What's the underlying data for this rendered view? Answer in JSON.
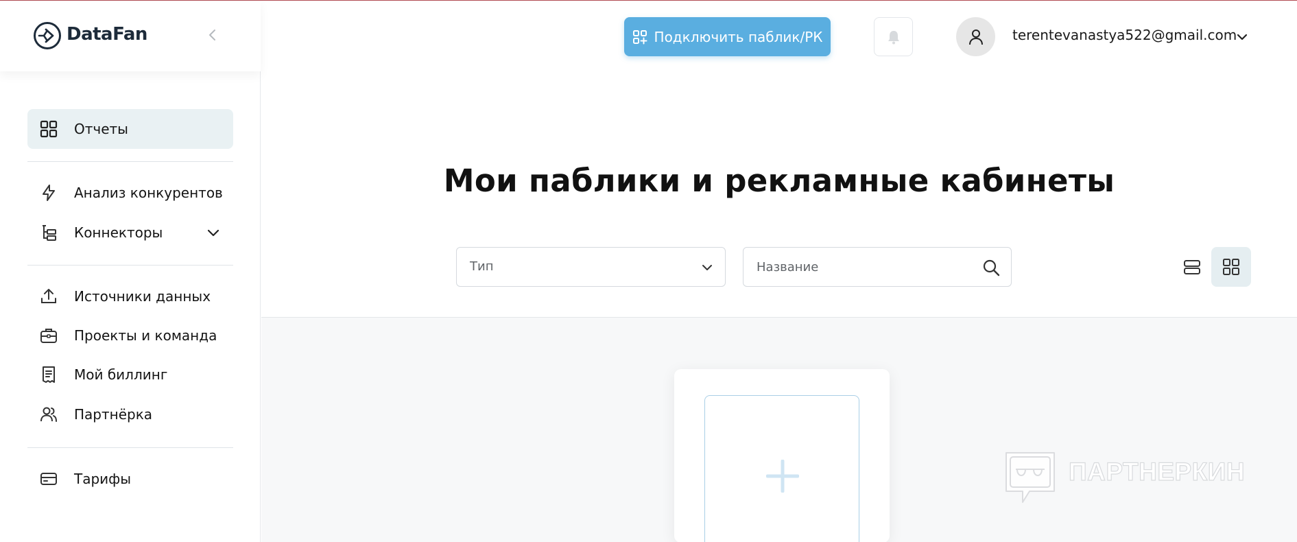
{
  "brand": {
    "name": "DataFan"
  },
  "header": {
    "connect_label": "Подключить паблик/РК",
    "user_email": "terentevanastya522@gmail.com"
  },
  "sidebar": {
    "items": [
      {
        "label": "Отчеты",
        "icon": "grid-icon",
        "active": true
      },
      {
        "label": "Анализ конкурентов",
        "icon": "lightning-icon"
      },
      {
        "label": "Коннекторы",
        "icon": "tree-icon",
        "expandable": true
      },
      {
        "label": "Источники данных",
        "icon": "upload-icon"
      },
      {
        "label": "Проекты и команда",
        "icon": "briefcase-icon"
      },
      {
        "label": "Мой биллинг",
        "icon": "receipt-icon"
      },
      {
        "label": "Партнёрка",
        "icon": "users-icon"
      },
      {
        "label": "Тарифы",
        "icon": "credit-card-icon"
      }
    ]
  },
  "main": {
    "title": "Мои паблики и рекламные кабинеты",
    "filters": {
      "type_value": "Тип",
      "name_placeholder": "Название"
    },
    "view_mode": "grid"
  },
  "watermark": {
    "text": "ПАРТНЕРКИН"
  },
  "colors": {
    "accent": "#5aaee0",
    "active_nav_bg": "#e9f1f3",
    "content_bg": "#f7f8f9",
    "top_border": "#b04a52"
  }
}
